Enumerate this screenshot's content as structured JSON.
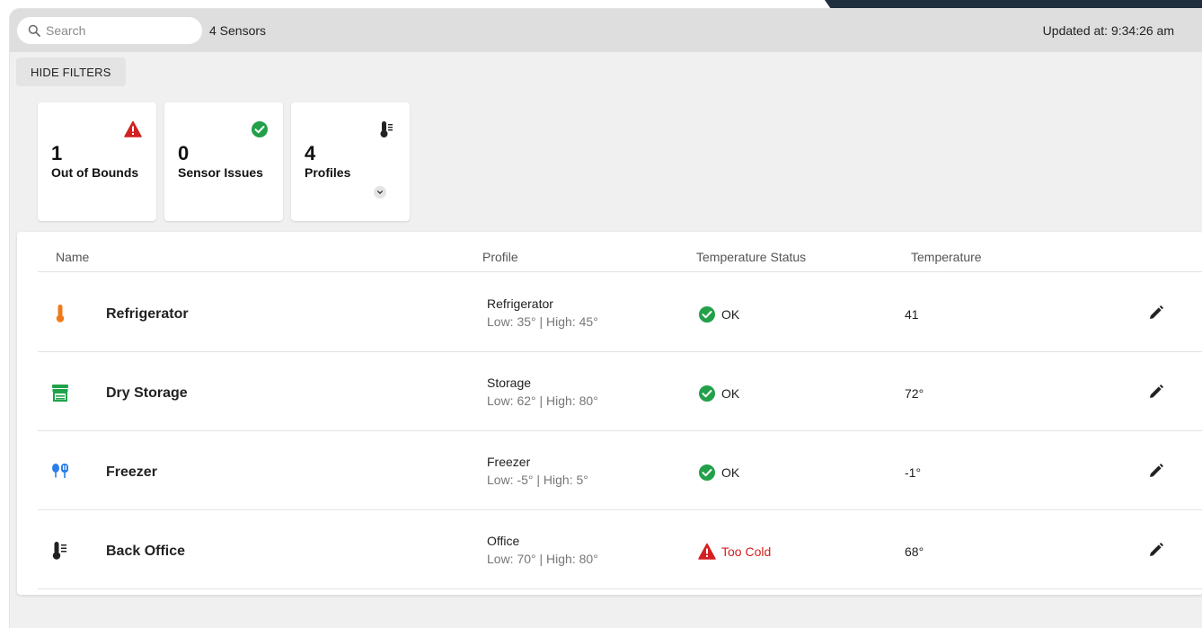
{
  "topbar": {
    "search_placeholder": "Search",
    "sensor_count": "4 Sensors",
    "updated": "Updated at: 9:34:26 am"
  },
  "filters": {
    "hide_label": "HIDE FILTERS"
  },
  "cards": [
    {
      "value": "1",
      "label": "Out of Bounds",
      "icon": "warning-icon"
    },
    {
      "value": "0",
      "label": "Sensor Issues",
      "icon": "check-circle-icon"
    },
    {
      "value": "4",
      "label": "Profiles",
      "icon": "thermometer-icon"
    }
  ],
  "table": {
    "headers": {
      "name": "Name",
      "profile": "Profile",
      "status": "Temperature Status",
      "temperature": "Temperature"
    },
    "rows": [
      {
        "name": "Refrigerator",
        "icon": "thermometer-orange-icon",
        "profile": "Refrigerator",
        "range": "Low: 35° | High: 45°",
        "status": "OK",
        "temperature": "41"
      },
      {
        "name": "Dry Storage",
        "icon": "storage-shelf-icon",
        "profile": "Storage",
        "range": "Low: 62° | High: 80°",
        "status": "OK",
        "temperature": "72°"
      },
      {
        "name": "Freezer",
        "icon": "freezer-popsicle-icon",
        "profile": "Freezer",
        "range": "Low: -5° | High: 5°",
        "status": "OK",
        "temperature": "-1°"
      },
      {
        "name": "Back Office",
        "icon": "thermometer-icon",
        "profile": "Office",
        "range": "Low: 70° | High: 80°",
        "status": "Too Cold",
        "temperature": "68°"
      }
    ]
  },
  "colors": {
    "ok_green": "#22a04a",
    "alert_red": "#d32020",
    "fridge_orange": "#f07a1a",
    "storage_green": "#1fa34a",
    "freezer_blue": "#2a7ee8",
    "accent_navy": "#1f2f3e"
  }
}
